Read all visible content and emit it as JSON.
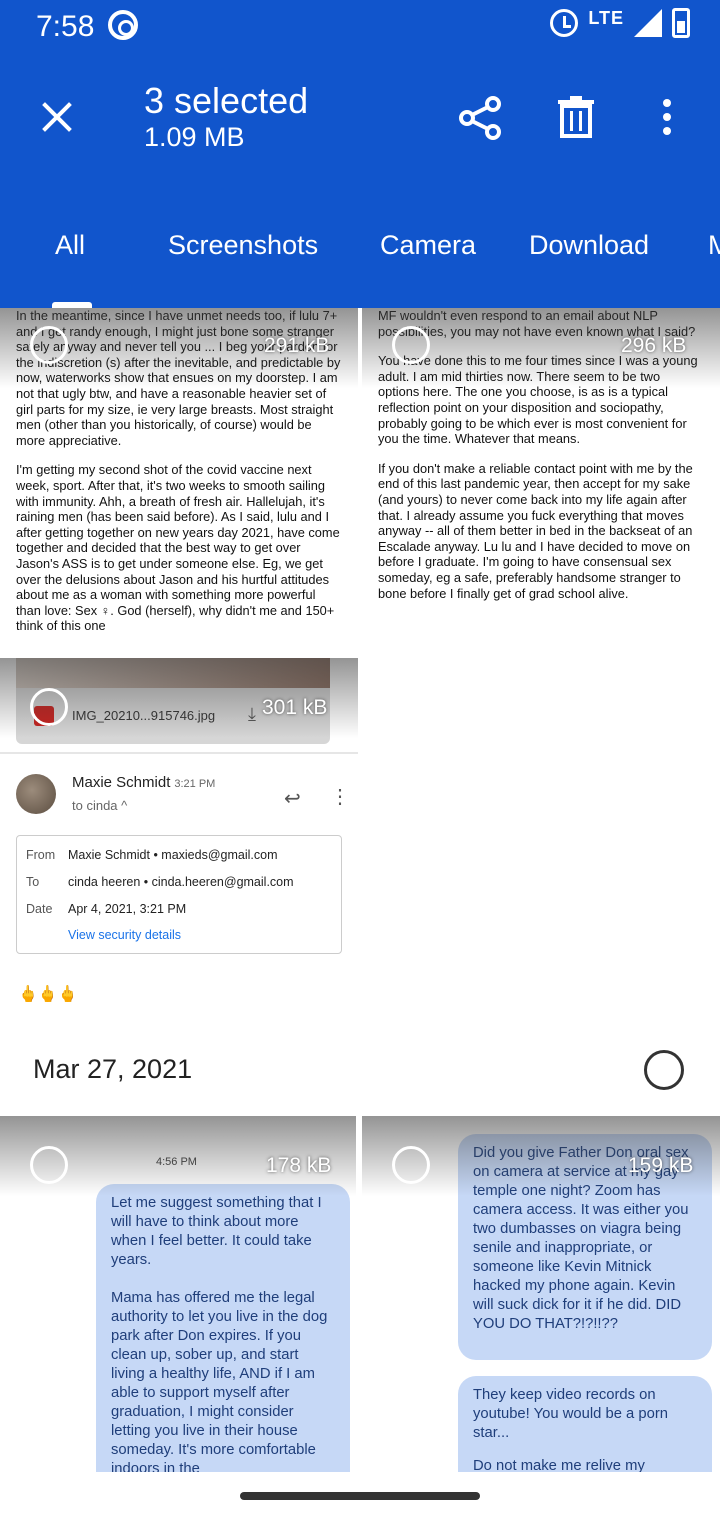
{
  "status_bar": {
    "time": "7:58",
    "network": "LTE"
  },
  "app_bar": {
    "selection_title": "3 selected",
    "selection_size": "1.09 MB",
    "icons": [
      "close-icon",
      "share-icon",
      "trash-icon",
      "more-vert-icon"
    ]
  },
  "tabs": [
    {
      "label": "All",
      "selected": true
    },
    {
      "label": "Screenshots"
    },
    {
      "label": "Camera"
    },
    {
      "label": "Download"
    },
    {
      "label": "M"
    }
  ],
  "thumbnails": {
    "t1": {
      "size": "291 kB",
      "paragraphs": [
        "In the meantime, since I have unmet needs too, if lulu 7+ and I get randy enough, I might just bone some stranger safely anyway and never tell you ... I beg your pardon for the indiscretion (s) after the inevitable, and predictable by now, waterworks show that ensues on my doorstep. I am not that ugly btw, and have a reasonable heavier set of girl parts for my size, ie very large breasts. Most straight men (other than you historically, of course) would be more appreciative.",
        "I'm getting my second shot of the covid vaccine next week, sport. After that, it's two weeks to smooth sailing with immunity. Ahh, a breath of fresh air. Hallelujah, it's raining men (has been said before). As I said, lulu and I after getting together on new years day 2021, have come together and decided that the best way to get over Jason's ASS is to get under someone else. Eg, we get over the delusions about Jason and his hurtful attitudes about me as a woman with something more powerful than love: Sex ♀. God (herself), why didn't me and 150+ think of this one"
      ]
    },
    "t2": {
      "size": "296 kB",
      "paragraphs": [
        "MF wouldn't even respond to an email about NLP possibilities, you may not have even known what I said?",
        "You have done this to me four times since I was a young adult. I am mid thirties now. There seem to be two options here. The one you choose, is as is a typical reflection point on your disposition and sociopathy, probably going to be which ever is most convenient for you the time. Whatever that means.",
        "If you don't make a reliable contact point with me by the end of this last pandemic year, then accept for my sake (and yours) to never come back into my life again after that. I already assume you fuck everything that moves anyway -- all of them better in bed in the backseat of an Escalade anyway. Lu lu and I have decided to move on before I graduate. I'm going to have consensual sex someday, eg a safe, preferably handsome stranger to bone before I finally get of grad school alive."
      ]
    },
    "t3": {
      "size": "301 kB",
      "attachment_name": "IMG_20210...915746.jpg",
      "email": {
        "sender": "Maxie Schmidt",
        "time": "3:21 PM",
        "to_line": "to cinda ^",
        "from_label": "From",
        "from_value": "Maxie Schmidt • maxieds@gmail.com",
        "to_label": "To",
        "to_value": "cinda heeren • cinda.heeren@gmail.com",
        "date_label": "Date",
        "date_value": "Apr 4, 2021, 3:21 PM",
        "security_link": "View security details",
        "emoji": "🖕🖕🖕"
      }
    }
  },
  "date_section": {
    "label": "Mar 27, 2021"
  },
  "thumbnails2": {
    "t4": {
      "size": "178 kB",
      "time": "4:56 PM",
      "paragraphs": [
        "Let me suggest something that I will have to think about more when I feel better. It could take years.",
        "Mama has offered me the legal authority to let you live in the dog park after Don expires. If you clean up, sober up, and start living a healthy life, AND if I am able to support myself after graduation, I might consider letting you live in their house someday. It's more comfortable indoors in the"
      ]
    },
    "t5": {
      "size": "159 kB",
      "bubble1": "Did you give Father Don oral sex on camera at service at my gay temple one night? Zoom has camera access. It was either you two dumbasses on viagra being senile and inappropriate, or someone like Kevin Mitnick hacked my phone again. Kevin will suck dick for it if he did. DID YOU DO THAT?!?!!??",
      "bubble2": "They keep video records on youtube! You would be a porn star...",
      "bubble2_tail": "Do not make me relive my"
    }
  }
}
